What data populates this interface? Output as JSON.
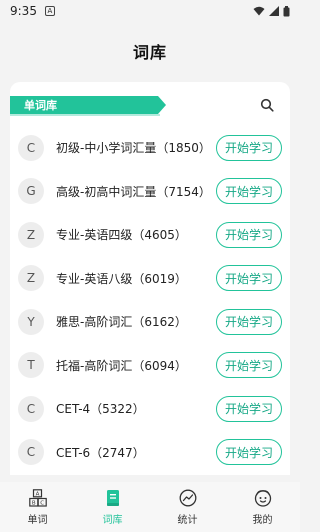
{
  "status_bar": {
    "time": "9:35",
    "app_icon": "A"
  },
  "header": {
    "title": "词库"
  },
  "section": {
    "tab_label": "单词库",
    "search_icon": "search-icon"
  },
  "wordbooks": [
    {
      "letter": "C",
      "label": "初级-中小学词汇量（1850）",
      "button": "开始学习"
    },
    {
      "letter": "G",
      "label": "高级-初高中词汇量（7154）",
      "button": "开始学习"
    },
    {
      "letter": "Z",
      "label": "专业-英语四级（4605）",
      "button": "开始学习"
    },
    {
      "letter": "Z",
      "label": "专业-英语八级（6019）",
      "button": "开始学习"
    },
    {
      "letter": "Y",
      "label": "雅思-高阶词汇（6162）",
      "button": "开始学习"
    },
    {
      "letter": "T",
      "label": "托福-高阶词汇（6094）",
      "button": "开始学习"
    },
    {
      "letter": "C",
      "label": "CET-4（5322）",
      "button": "开始学习"
    },
    {
      "letter": "C",
      "label": "CET-6（2747）",
      "button": "开始学习"
    }
  ],
  "bottom_nav": [
    {
      "label": "单词",
      "icon": "abc-blocks-icon",
      "active": false
    },
    {
      "label": "词库",
      "icon": "book-icon",
      "active": true
    },
    {
      "label": "统计",
      "icon": "chart-icon",
      "active": false
    },
    {
      "label": "我的",
      "icon": "face-icon",
      "active": false
    }
  ],
  "colors": {
    "accent": "#22c39a",
    "background": "#f3f3f3",
    "card": "#ffffff"
  }
}
